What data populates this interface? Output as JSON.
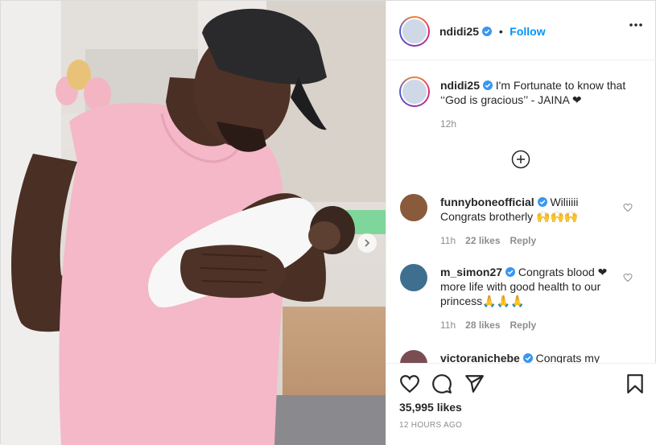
{
  "post": {
    "author": "ndidi25",
    "follow_label": "Follow",
    "separator": "•",
    "caption": "I'm Fortunate to know that ‘‘God is gracious’’ - JAINA ❤",
    "caption_time": "12h",
    "like_count": "35,995 likes",
    "time_ago": "12 HOURS AGO"
  },
  "comments": [
    {
      "user": "funnyboneofficial",
      "text": "Wiliiiii Congrats brotherly 🙌🙌🙌",
      "time": "11h",
      "likes": "22 likes",
      "reply": "Reply"
    },
    {
      "user": "m_simon27",
      "text": "Congrats blood ❤more life with good health to our princess🙏🙏🙏",
      "time": "11h",
      "likes": "28 likes",
      "reply": "Reply"
    },
    {
      "user": "victoranichebe",
      "text": "Congrats my"
    }
  ],
  "colors": {
    "follow": "#0095f6",
    "verified": "#3897f0",
    "secondary_text": "#8e8e8e",
    "shirt": "#f4b8c8"
  },
  "icons": [
    "more-options-icon",
    "add-comment-icon",
    "like-heart-icon",
    "comment-icon",
    "share-icon",
    "bookmark-icon",
    "verified-badge-icon",
    "next-photo-icon"
  ]
}
